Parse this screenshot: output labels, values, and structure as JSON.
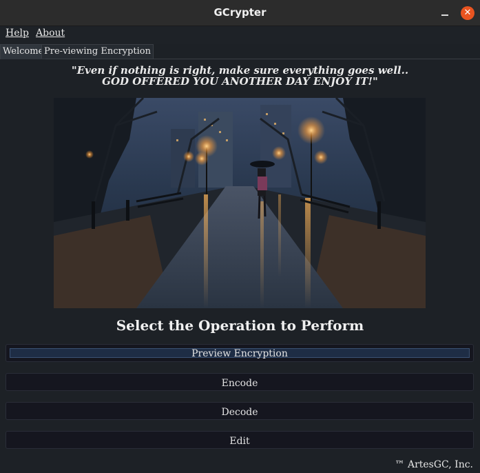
{
  "window": {
    "title": "GCrypter",
    "minimize_glyph": "",
    "close_glyph": "✕"
  },
  "menu": {
    "help": "Help",
    "about": "About"
  },
  "tabs": [
    {
      "label": "Welcome",
      "active": true
    },
    {
      "label": "Pre-viewing Encryption",
      "active": false
    }
  ],
  "welcome": {
    "quote_line1": "\"Even if nothing is right, make sure everything goes well..",
    "quote_line2": "GOD OFFERED YOU ANOTHER DAY ENJOY IT!\"",
    "image_icon": "rainy-park-night-photo",
    "headline": "Select the Operation to Perform",
    "buttons": {
      "preview": "Preview Encryption",
      "encode": "Encode",
      "decode": "Decode",
      "edit": "Edit"
    },
    "footer": "™ ArtesGC, Inc."
  },
  "colors": {
    "accent_close": "#e95420",
    "focus_border": "#3b5273"
  }
}
